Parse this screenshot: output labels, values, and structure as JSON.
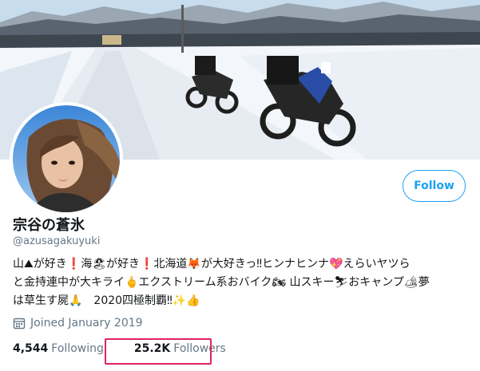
{
  "profile": {
    "display_name": "宗谷の蒼氷",
    "handle": "@azusagakuyuki",
    "follow_label": "Follow",
    "bio_lines": [
      "山⛰が好き❗海🏖が好き❗北海道🦊が大好きっ‼ヒンナヒンナ💖えらいヤツら",
      "と金持連中が大キライ🖕エクストリーム系おバイク🏍 山スキー⛷おキャンプ🏕夢",
      "は草生す屍🙏　2020四極制覇‼✨👍"
    ],
    "joined": "Joined January 2019",
    "following_count": "4,544",
    "following_label": "Following",
    "followers_count": "25.2K",
    "followers_label": "Followers"
  },
  "colors": {
    "accent": "#1da1f2",
    "highlight_box": "#e0245e",
    "secondary_text": "#657786"
  },
  "icons": {
    "joined": "calendar-icon"
  }
}
